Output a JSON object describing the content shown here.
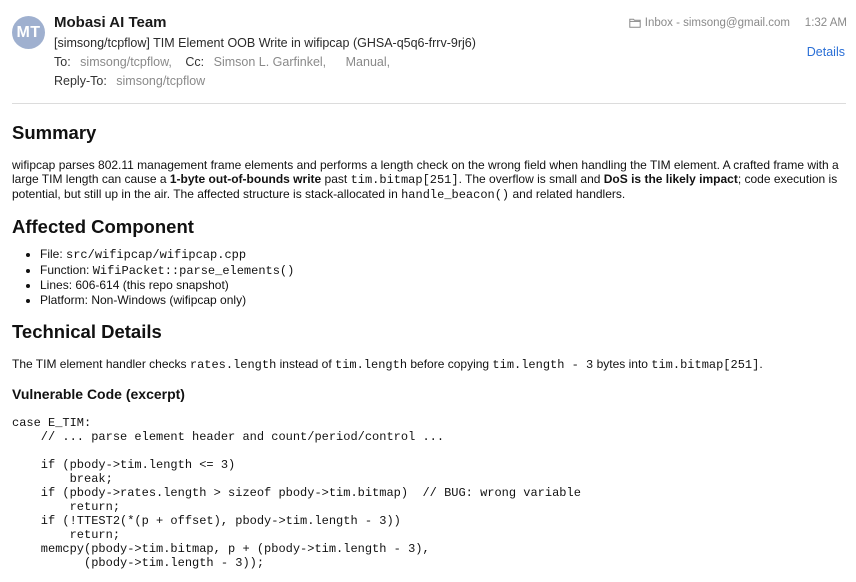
{
  "header": {
    "avatar_initials": "MT",
    "sender": "Mobasi AI Team",
    "subject": "[simsong/tcpflow] TIM Element OOB Write in wifipcap (GHSA-q5q6-frrv-9rj6)",
    "to_label": "To:",
    "to_value": "simsong/tcpflow,",
    "cc_label": "Cc:",
    "cc_value1": "Simson L. Garfinkel,",
    "cc_value2": "Manual,",
    "reply_label": "Reply-To:",
    "reply_value": "simsong/tcpflow",
    "mailbox": "Inbox - simsong@gmail.com",
    "time": "1:32 AM",
    "details_link": "Details"
  },
  "summary": {
    "heading": "Summary",
    "p_part1": "wifipcap parses 802.11 management frame elements and performs a length check on the wrong field when handling the TIM element. A crafted frame with a large TIM length can cause a ",
    "bold1": "1-byte out-of-bounds write",
    "p_part2": " past ",
    "code1": "tim.bitmap[251]",
    "p_part3": ". The overflow is small and ",
    "bold2": "DoS is the likely impact",
    "p_part4": "; code execution is potential, but still up in the air. The affected structure is stack-allocated in ",
    "code2": "handle_beacon()",
    "p_part5": " and related handlers."
  },
  "affected": {
    "heading": "Affected Component",
    "file_label": "File: ",
    "file_value": "src/wifipcap/wifipcap.cpp",
    "function_label": "Function: ",
    "function_value": "WifiPacket::parse_elements()",
    "lines": "Lines: 606-614 (this repo snapshot)",
    "platform": "Platform: Non-Windows (wifipcap only)"
  },
  "technical": {
    "heading": "Technical Details",
    "t1": "The TIM element handler checks ",
    "c1": "rates.length",
    "t2": " instead of ",
    "c2": "tim.length",
    "t3": " before copying ",
    "c3": "tim.length - 3",
    "t4": " bytes into ",
    "c4": "tim.bitmap[251]",
    "t5": ".",
    "vuln_heading": "Vulnerable Code (excerpt)",
    "code": "case E_TIM:\n    // ... parse element header and count/period/control ...\n\n    if (pbody->tim.length <= 3)\n        break;\n    if (pbody->rates.length > sizeof pbody->tim.bitmap)  // BUG: wrong variable\n        return;\n    if (!TTEST2(*(p + offset), pbody->tim.length - 3))\n        return;\n    memcpy(pbody->tim.bitmap, p + (pbody->tim.length - 3),\n          (pbody->tim.length - 3));"
  }
}
